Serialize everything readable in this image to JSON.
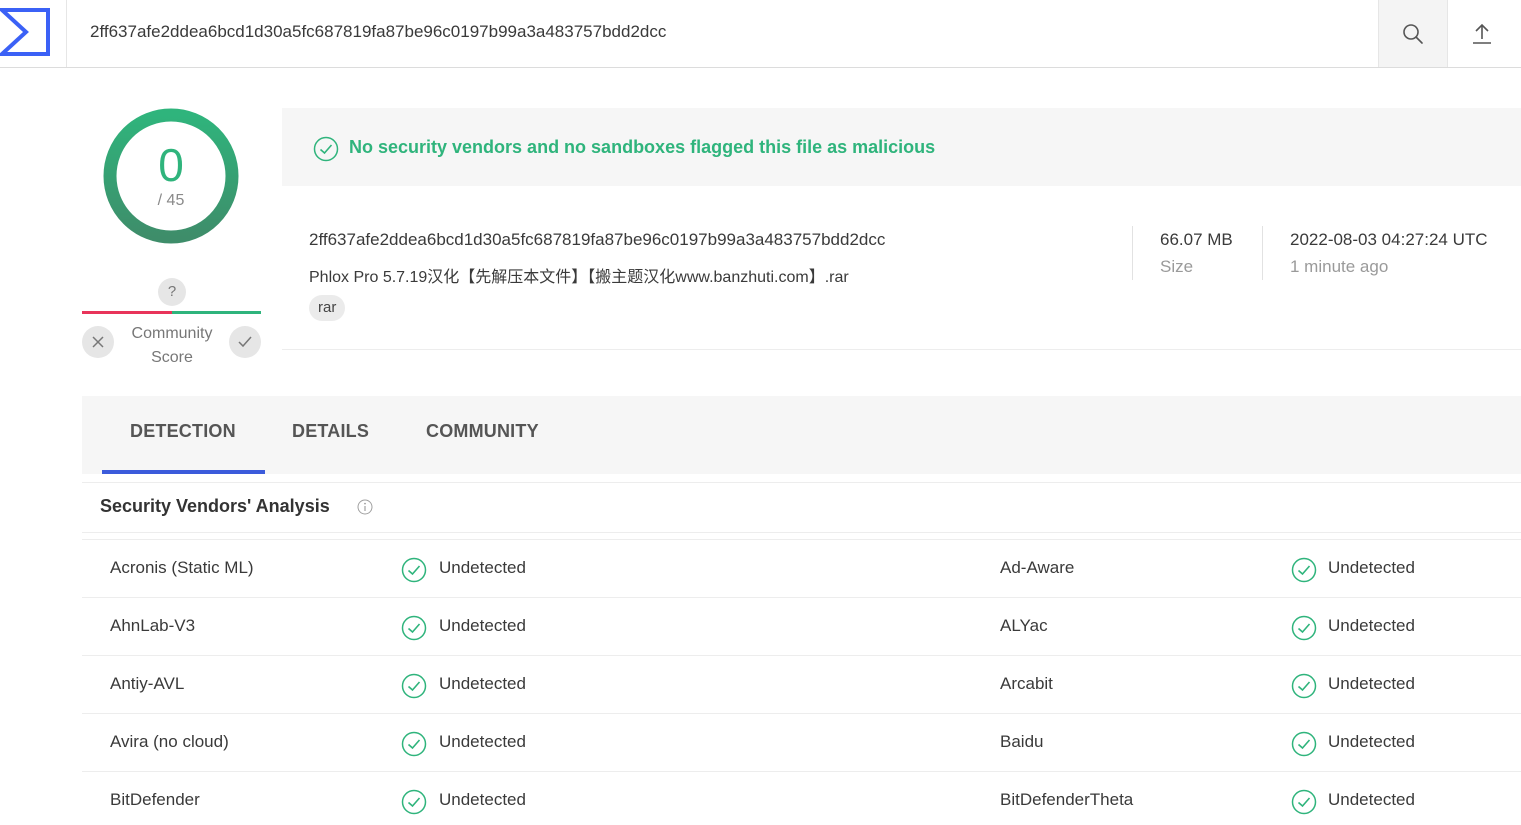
{
  "header": {
    "search_value": "2ff637afe2ddea6bcd1d30a5fc687819fa87be96c0197b99a3a483757bdd2dcc"
  },
  "score": {
    "detections": "0",
    "total": "/ 45"
  },
  "community": {
    "question": "?",
    "label_line1": "Community",
    "label_line2": "Score"
  },
  "status": {
    "message": "No security vendors and no sandboxes flagged this file as malicious"
  },
  "file": {
    "hash": "2ff637afe2ddea6bcd1d30a5fc687819fa87be96c0197b99a3a483757bdd2dcc",
    "name": "Phlox Pro 5.7.19汉化【先解压本文件】【搬主题汉化www.banzhuti.com】.rar",
    "tag": "rar",
    "size": "66.07 MB",
    "size_label": "Size",
    "date": "2022-08-03 04:27:24 UTC",
    "date_relative": "1 minute ago"
  },
  "tabs": [
    {
      "label": "DETECTION"
    },
    {
      "label": "DETAILS"
    },
    {
      "label": "COMMUNITY"
    }
  ],
  "analysis": {
    "title": "Security Vendors' Analysis",
    "rows": [
      {
        "left_vendor": "Acronis (Static ML)",
        "left_result": "Undetected",
        "right_vendor": "Ad-Aware",
        "right_result": "Undetected"
      },
      {
        "left_vendor": "AhnLab-V3",
        "left_result": "Undetected",
        "right_vendor": "ALYac",
        "right_result": "Undetected"
      },
      {
        "left_vendor": "Antiy-AVL",
        "left_result": "Undetected",
        "right_vendor": "Arcabit",
        "right_result": "Undetected"
      },
      {
        "left_vendor": "Avira (no cloud)",
        "left_result": "Undetected",
        "right_vendor": "Baidu",
        "right_result": "Undetected"
      },
      {
        "left_vendor": "BitDefender",
        "left_result": "Undetected",
        "right_vendor": "BitDefenderTheta",
        "right_result": "Undetected"
      }
    ]
  },
  "colors": {
    "clean": "#2fb47c",
    "malicious": "#e8345a",
    "accent": "#3b5bdb"
  }
}
